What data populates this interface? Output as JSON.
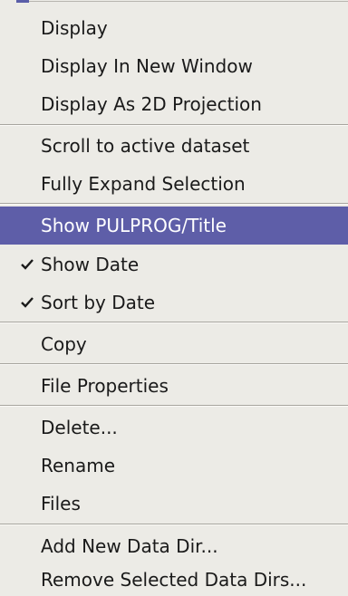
{
  "menu": {
    "items": [
      {
        "label": "Display"
      },
      {
        "label": "Display In New Window"
      },
      {
        "label": "Display As 2D Projection"
      },
      {
        "label": "Scroll to active dataset"
      },
      {
        "label": "Fully Expand Selection"
      },
      {
        "label": "Show PULPROG/Title",
        "state": "highlighted"
      },
      {
        "label": "Show Date",
        "checked": true
      },
      {
        "label": "Sort by Date",
        "checked": true
      },
      {
        "label": "Copy"
      },
      {
        "label": "File Properties"
      },
      {
        "label": "Delete..."
      },
      {
        "label": "Rename"
      },
      {
        "label": "Files"
      },
      {
        "label": "Add New Data Dir..."
      },
      {
        "label": "Remove Selected Data Dirs..."
      }
    ]
  },
  "colors": {
    "menu_background": "#ecebe6",
    "highlight_background": "#5e5ea8",
    "highlight_text": "#ffffff",
    "text": "#1a1a1a"
  },
  "icons": {
    "checkmark": "check-icon"
  }
}
